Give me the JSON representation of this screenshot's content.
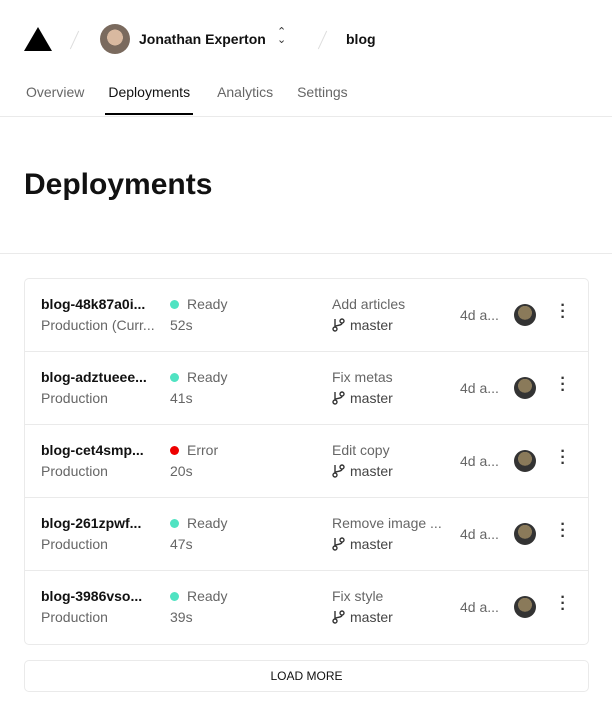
{
  "header": {
    "user": "Jonathan Experton",
    "project": "blog"
  },
  "tabs": [
    "Overview",
    "Deployments",
    "Analytics",
    "Settings"
  ],
  "title": "Deployments",
  "colors": {
    "ready": "#50e3c2",
    "error": "#e00"
  },
  "deployments": [
    {
      "name": "blog-48k87a0i...",
      "env": "Production (Curr...",
      "status": "Ready",
      "duration": "52s",
      "message": "Add articles",
      "branch": "master",
      "age": "4d a..."
    },
    {
      "name": "blog-adztueee...",
      "env": "Production",
      "status": "Ready",
      "duration": "41s",
      "message": "Fix metas",
      "branch": "master",
      "age": "4d a..."
    },
    {
      "name": "blog-cet4smp...",
      "env": "Production",
      "status": "Error",
      "duration": "20s",
      "message": "Edit copy",
      "branch": "master",
      "age": "4d a..."
    },
    {
      "name": "blog-261zpwf...",
      "env": "Production",
      "status": "Ready",
      "duration": "47s",
      "message": "Remove image ...",
      "branch": "master",
      "age": "4d a..."
    },
    {
      "name": "blog-3986vso...",
      "env": "Production",
      "status": "Ready",
      "duration": "39s",
      "message": "Fix style",
      "branch": "master",
      "age": "4d a..."
    }
  ],
  "load_more": "LOAD MORE"
}
